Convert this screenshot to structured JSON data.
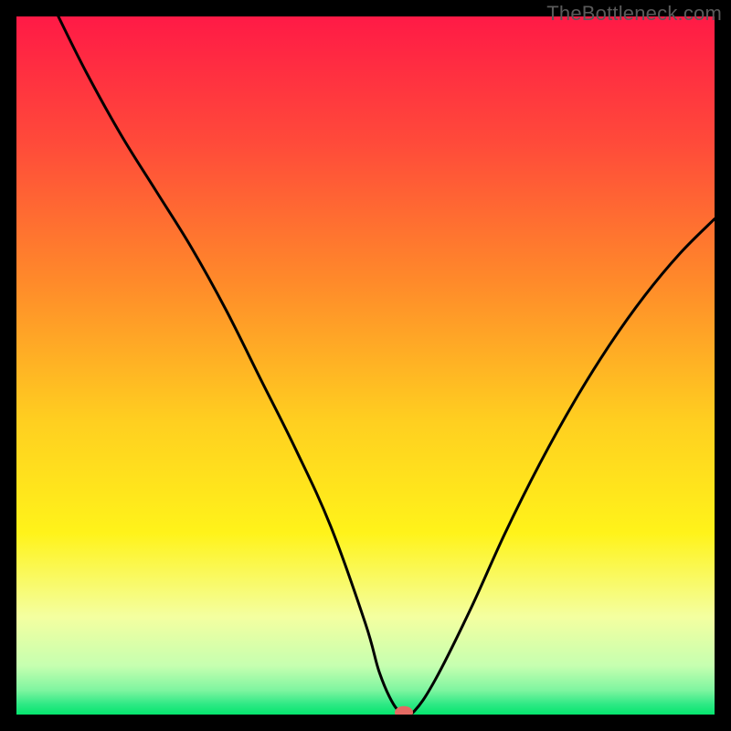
{
  "watermark": "TheBottleneck.com",
  "chart_data": {
    "type": "line",
    "title": "",
    "xlabel": "",
    "ylabel": "",
    "xlim": [
      0,
      100
    ],
    "ylim": [
      0,
      100
    ],
    "grid": false,
    "legend": false,
    "background": {
      "description": "vertical gradient red→orange→yellow→pale-green→green",
      "stops": [
        {
          "pos": 0.0,
          "color": "#ff1a46"
        },
        {
          "pos": 0.18,
          "color": "#ff4a3a"
        },
        {
          "pos": 0.38,
          "color": "#ff8a2a"
        },
        {
          "pos": 0.58,
          "color": "#ffcf20"
        },
        {
          "pos": 0.74,
          "color": "#fff31a"
        },
        {
          "pos": 0.86,
          "color": "#f4ffa0"
        },
        {
          "pos": 0.93,
          "color": "#c6ffb0"
        },
        {
          "pos": 0.965,
          "color": "#7ff5a0"
        },
        {
          "pos": 0.985,
          "color": "#2fe985"
        },
        {
          "pos": 1.0,
          "color": "#05e56e"
        }
      ]
    },
    "series": [
      {
        "name": "bottleneck-curve",
        "stroke": "#000000",
        "x": [
          6,
          10,
          15,
          20,
          25,
          30,
          35,
          40,
          45,
          50,
          52,
          54,
          55.5,
          57,
          60,
          65,
          70,
          75,
          80,
          85,
          90,
          95,
          100
        ],
        "y": [
          100,
          92,
          83,
          75,
          67,
          58,
          48,
          38,
          27,
          13,
          6,
          1.5,
          0.2,
          0.5,
          5,
          15,
          26,
          36,
          45,
          53,
          60,
          66,
          71
        ]
      }
    ],
    "marker": {
      "name": "selected-point",
      "x": 55.5,
      "y": 0.3,
      "color": "#e46a63",
      "rx": 10,
      "ry": 7
    }
  }
}
